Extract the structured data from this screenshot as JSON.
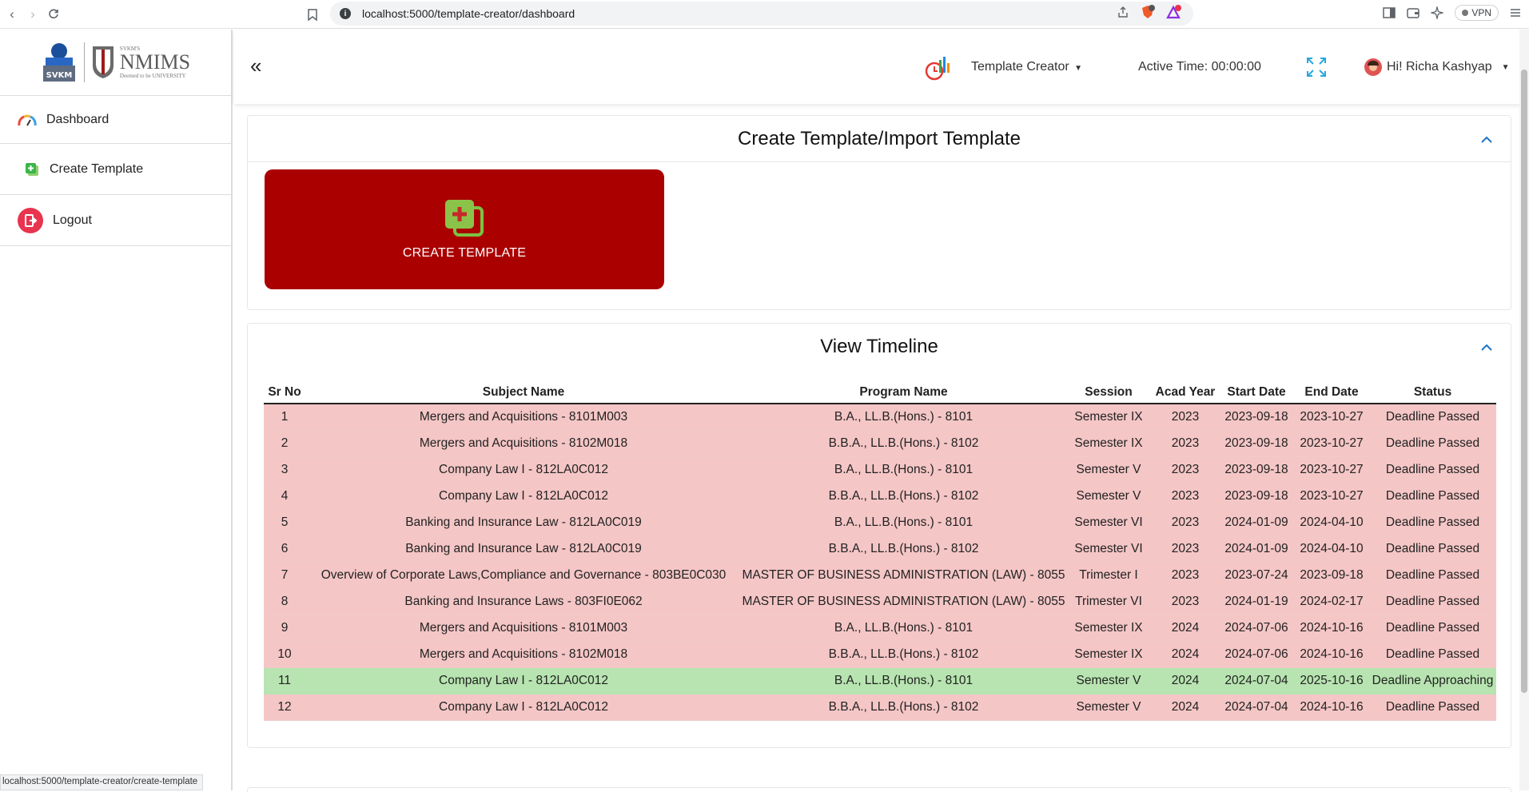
{
  "browser": {
    "url": "localhost:5000/template-creator/dashboard",
    "vpn_label": "VPN",
    "status_url": "localhost:5000/template-creator/create-template"
  },
  "sidebar": {
    "logo": {
      "svkm": "SVKM",
      "nmims": "NMIMS",
      "nmims_top": "SVKM'S",
      "nmims_sub": "Deemed to be UNIVERSITY"
    },
    "items": [
      {
        "label": "Dashboard",
        "icon": "dashboard-gauge-icon"
      },
      {
        "label": "Create Template",
        "icon": "add-template-icon"
      },
      {
        "label": "Logout",
        "icon": "logout-icon"
      }
    ]
  },
  "header": {
    "role_label": "Template Creator",
    "active_time": "Active Time: 00:00:00",
    "user_greeting": "Hi! Richa Kashyap"
  },
  "create_panel": {
    "title": "Create Template/Import Template",
    "button_label": "CREATE TEMPLATE"
  },
  "timeline_panel": {
    "title": "View Timeline",
    "columns": [
      "Sr No",
      "Subject Name",
      "Program Name",
      "Session",
      "Acad Year",
      "Start Date",
      "End Date",
      "Status"
    ],
    "rows": [
      {
        "cells": [
          "1",
          "Mergers and Acquisitions - 8101M003",
          "B.A., LL.B.(Hons.) - 8101",
          "Semester IX",
          "2023",
          "2023-09-18",
          "2023-10-27",
          "Deadline Passed"
        ],
        "state": "passed"
      },
      {
        "cells": [
          "2",
          "Mergers and Acquisitions - 8102M018",
          "B.B.A., LL.B.(Hons.) - 8102",
          "Semester IX",
          "2023",
          "2023-09-18",
          "2023-10-27",
          "Deadline Passed"
        ],
        "state": "passed"
      },
      {
        "cells": [
          "3",
          "Company Law I - 812LA0C012",
          "B.A., LL.B.(Hons.) - 8101",
          "Semester V",
          "2023",
          "2023-09-18",
          "2023-10-27",
          "Deadline Passed"
        ],
        "state": "passed"
      },
      {
        "cells": [
          "4",
          "Company Law I - 812LA0C012",
          "B.B.A., LL.B.(Hons.) - 8102",
          "Semester V",
          "2023",
          "2023-09-18",
          "2023-10-27",
          "Deadline Passed"
        ],
        "state": "passed"
      },
      {
        "cells": [
          "5",
          "Banking and Insurance Law - 812LA0C019",
          "B.A., LL.B.(Hons.) - 8101",
          "Semester VI",
          "2023",
          "2024-01-09",
          "2024-04-10",
          "Deadline Passed"
        ],
        "state": "passed"
      },
      {
        "cells": [
          "6",
          "Banking and Insurance Law - 812LA0C019",
          "B.B.A., LL.B.(Hons.) - 8102",
          "Semester VI",
          "2023",
          "2024-01-09",
          "2024-04-10",
          "Deadline Passed"
        ],
        "state": "passed"
      },
      {
        "cells": [
          "7",
          "Overview of Corporate Laws,Compliance and Governance - 803BE0C030",
          "MASTER OF BUSINESS ADMINISTRATION (LAW) - 8055",
          "Trimester I",
          "2023",
          "2023-07-24",
          "2023-09-18",
          "Deadline Passed"
        ],
        "state": "passed"
      },
      {
        "cells": [
          "8",
          "Banking and Insurance Laws - 803FI0E062",
          "MASTER OF BUSINESS ADMINISTRATION (LAW) - 8055",
          "Trimester VI",
          "2023",
          "2024-01-19",
          "2024-02-17",
          "Deadline Passed"
        ],
        "state": "passed"
      },
      {
        "cells": [
          "9",
          "Mergers and Acquisitions - 8101M003",
          "B.A., LL.B.(Hons.) - 8101",
          "Semester IX",
          "2024",
          "2024-07-06",
          "2024-10-16",
          "Deadline Passed"
        ],
        "state": "passed"
      },
      {
        "cells": [
          "10",
          "Mergers and Acquisitions - 8102M018",
          "B.B.A., LL.B.(Hons.) - 8102",
          "Semester IX",
          "2024",
          "2024-07-06",
          "2024-10-16",
          "Deadline Passed"
        ],
        "state": "passed"
      },
      {
        "cells": [
          "11",
          "Company Law I - 812LA0C012",
          "B.A., LL.B.(Hons.) - 8101",
          "Semester V",
          "2024",
          "2024-07-04",
          "2025-10-16",
          "Deadline Approaching"
        ],
        "state": "approach"
      },
      {
        "cells": [
          "12",
          "Company Law I - 812LA0C012",
          "B.B.A., LL.B.(Hons.) - 8102",
          "Semester V",
          "2024",
          "2024-07-04",
          "2024-10-16",
          "Deadline Passed"
        ],
        "state": "passed"
      }
    ]
  },
  "colors": {
    "create_button": "#aa0000",
    "row_passed": "#f5c6c6",
    "row_approaching": "#b7e4b0",
    "accent_blue": "#1a73c8"
  }
}
